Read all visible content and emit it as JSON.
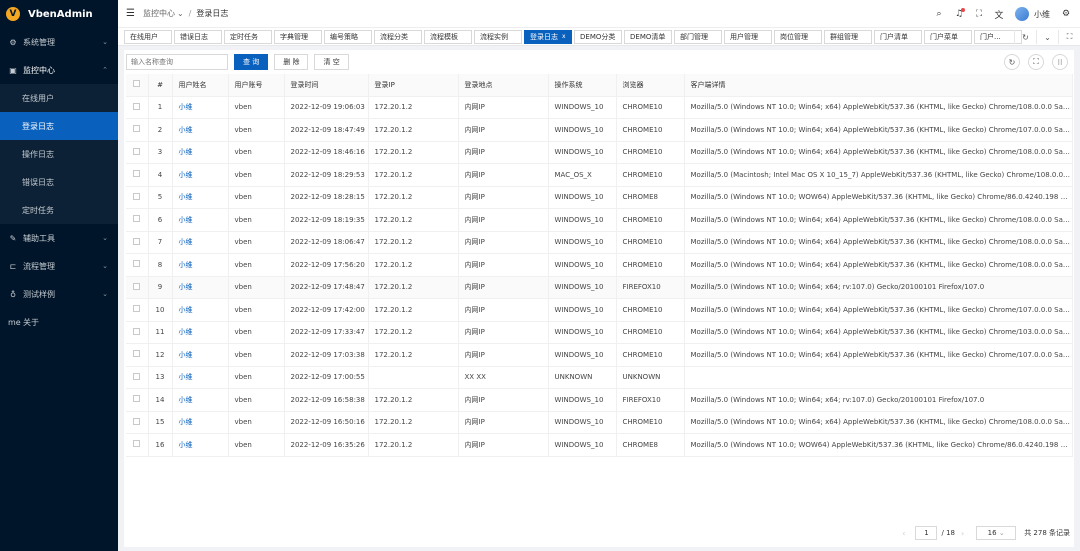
{
  "app": {
    "name": "VbenAdmin",
    "logo_letter": "V"
  },
  "sidebar": {
    "items": [
      {
        "label": "系统管理",
        "icon": "gear-icon",
        "glyph": "⚙",
        "arrow": "⌄"
      },
      {
        "label": "监控中心",
        "icon": "monitor-icon",
        "glyph": "▣",
        "arrow": "⌃",
        "open": true,
        "children": [
          {
            "label": "在线用户"
          },
          {
            "label": "登录日志",
            "active": true
          },
          {
            "label": "操作日志"
          },
          {
            "label": "错误日志"
          },
          {
            "label": "定时任务"
          }
        ]
      },
      {
        "label": "辅助工具",
        "icon": "tool-icon",
        "glyph": "✎",
        "arrow": "⌄"
      },
      {
        "label": "流程管理",
        "icon": "flow-icon",
        "glyph": "⊏",
        "arrow": "⌄"
      },
      {
        "label": "测试样例",
        "icon": "bulb-icon",
        "glyph": "♁",
        "arrow": "⌄"
      },
      {
        "label": "关于",
        "icon": "about-icon",
        "glyph": "me",
        "arrow": ""
      }
    ]
  },
  "header": {
    "breadcrumb": [
      "监控中心",
      "登录日志"
    ],
    "breadcrumb_caret": "⌄",
    "breadcrumb_sep": "/",
    "username": "小维",
    "icons": {
      "search": "⌕",
      "bell": "♫",
      "expand": "⛶",
      "translate": "文",
      "settings": "⚙"
    }
  },
  "tabs": {
    "items": [
      "在线用户",
      "错误日志",
      "定时任务",
      "字典管理",
      "编号策略",
      "流程分类",
      "流程模板",
      "流程实例",
      "登录日志",
      "DEMO分类",
      "DEMO清单",
      "部门管理",
      "用户管理",
      "岗位管理",
      "群组管理",
      "门户清单",
      "门户菜单",
      "门户..."
    ],
    "active_index": 8,
    "close_glyph": "x",
    "controls": [
      "↻",
      "⌄",
      "⛶"
    ]
  },
  "toolbar": {
    "search_placeholder": "输入名称查询",
    "query_label": "查 询",
    "delete_label": "删 除",
    "clear_label": "清 空",
    "tools": [
      "↻",
      "⛶",
      "⁝⁝"
    ]
  },
  "table": {
    "columns": [
      "#",
      "用户姓名",
      "用户账号",
      "登录时间",
      "登录IP",
      "登录地点",
      "操作系统",
      "浏览器",
      "客户端详情"
    ],
    "rows": [
      [
        "1",
        "小维",
        "vben",
        "2022-12-09 19:06:03",
        "172.20.1.2",
        "内网IP",
        "WINDOWS_10",
        "CHROME10",
        "Mozilla/5.0 (Windows NT 10.0; Win64; x64) AppleWebKit/537.36 (KHTML, like Gecko) Chrome/108.0.0.0 Safari/537..."
      ],
      [
        "2",
        "小维",
        "vben",
        "2022-12-09 18:47:49",
        "172.20.1.2",
        "内网IP",
        "WINDOWS_10",
        "CHROME10",
        "Mozilla/5.0 (Windows NT 10.0; Win64; x64) AppleWebKit/537.36 (KHTML, like Gecko) Chrome/107.0.0.0 Safari/537..."
      ],
      [
        "3",
        "小维",
        "vben",
        "2022-12-09 18:46:16",
        "172.20.1.2",
        "内网IP",
        "WINDOWS_10",
        "CHROME10",
        "Mozilla/5.0 (Windows NT 10.0; Win64; x64) AppleWebKit/537.36 (KHTML, like Gecko) Chrome/108.0.0.0 Safari/537..."
      ],
      [
        "4",
        "小维",
        "vben",
        "2022-12-09 18:29:53",
        "172.20.1.2",
        "内网IP",
        "MAC_OS_X",
        "CHROME10",
        "Mozilla/5.0 (Macintosh; Intel Mac OS X 10_15_7) AppleWebKit/537.36 (KHTML, like Gecko) Chrome/108.0.0.0 Safa..."
      ],
      [
        "5",
        "小维",
        "vben",
        "2022-12-09 18:28:15",
        "172.20.1.2",
        "内网IP",
        "WINDOWS_10",
        "CHROME8",
        "Mozilla/5.0 (Windows NT 10.0; WOW64) AppleWebKit/537.36 (KHTML, like Gecko) Chrome/86.0.4240.198 Safari/5..."
      ],
      [
        "6",
        "小维",
        "vben",
        "2022-12-09 18:19:35",
        "172.20.1.2",
        "内网IP",
        "WINDOWS_10",
        "CHROME10",
        "Mozilla/5.0 (Windows NT 10.0; Win64; x64) AppleWebKit/537.36 (KHTML, like Gecko) Chrome/108.0.0.0 Safari/537..."
      ],
      [
        "7",
        "小维",
        "vben",
        "2022-12-09 18:06:47",
        "172.20.1.2",
        "内网IP",
        "WINDOWS_10",
        "CHROME10",
        "Mozilla/5.0 (Windows NT 10.0; Win64; x64) AppleWebKit/537.36 (KHTML, like Gecko) Chrome/108.0.0.0 Safari/537..."
      ],
      [
        "8",
        "小维",
        "vben",
        "2022-12-09 17:56:20",
        "172.20.1.2",
        "内网IP",
        "WINDOWS_10",
        "CHROME10",
        "Mozilla/5.0 (Windows NT 10.0; Win64; x64) AppleWebKit/537.36 (KHTML, like Gecko) Chrome/108.0.0.0 Safari/537..."
      ],
      [
        "9",
        "小维",
        "vben",
        "2022-12-09 17:48:47",
        "172.20.1.2",
        "内网IP",
        "WINDOWS_10",
        "FIREFOX10",
        "Mozilla/5.0 (Windows NT 10.0; Win64; x64; rv:107.0) Gecko/20100101 Firefox/107.0"
      ],
      [
        "10",
        "小维",
        "vben",
        "2022-12-09 17:42:00",
        "172.20.1.2",
        "内网IP",
        "WINDOWS_10",
        "CHROME10",
        "Mozilla/5.0 (Windows NT 10.0; Win64; x64) AppleWebKit/537.36 (KHTML, like Gecko) Chrome/107.0.0.0 Safari/537..."
      ],
      [
        "11",
        "小维",
        "vben",
        "2022-12-09 17:33:47",
        "172.20.1.2",
        "内网IP",
        "WINDOWS_10",
        "CHROME10",
        "Mozilla/5.0 (Windows NT 10.0; Win64; x64) AppleWebKit/537.36 (KHTML, like Gecko) Chrome/103.0.0.0 Safari/537..."
      ],
      [
        "12",
        "小维",
        "vben",
        "2022-12-09 17:03:38",
        "172.20.1.2",
        "内网IP",
        "WINDOWS_10",
        "CHROME10",
        "Mozilla/5.0 (Windows NT 10.0; Win64; x64) AppleWebKit/537.36 (KHTML, like Gecko) Chrome/107.0.0.0 Safari/537..."
      ],
      [
        "13",
        "小维",
        "vben",
        "2022-12-09 17:00:55",
        "",
        "XX XX",
        "UNKNOWN",
        "UNKNOWN",
        ""
      ],
      [
        "14",
        "小维",
        "vben",
        "2022-12-09 16:58:38",
        "172.20.1.2",
        "内网IP",
        "WINDOWS_10",
        "FIREFOX10",
        "Mozilla/5.0 (Windows NT 10.0; Win64; x64; rv:107.0) Gecko/20100101 Firefox/107.0"
      ],
      [
        "15",
        "小维",
        "vben",
        "2022-12-09 16:50:16",
        "172.20.1.2",
        "内网IP",
        "WINDOWS_10",
        "CHROME10",
        "Mozilla/5.0 (Windows NT 10.0; Win64; x64) AppleWebKit/537.36 (KHTML, like Gecko) Chrome/108.0.0.0 Safari/537..."
      ],
      [
        "16",
        "小维",
        "vben",
        "2022-12-09 16:35:26",
        "172.20.1.2",
        "内网IP",
        "WINDOWS_10",
        "CHROME8",
        "Mozilla/5.0 (Windows NT 10.0; WOW64) AppleWebKit/537.36 (KHTML, like Gecko) Chrome/86.0.4240.198 Safari/5..."
      ]
    ]
  },
  "pagination": {
    "prev": "‹",
    "next": "›",
    "current_page": "1",
    "total_pages": "/ 18",
    "page_size": "16",
    "page_size_caret": "⌄",
    "total": "共 278 条记录"
  },
  "colors": {
    "primary": "#0960bd",
    "sidebar_bg": "#001529"
  }
}
